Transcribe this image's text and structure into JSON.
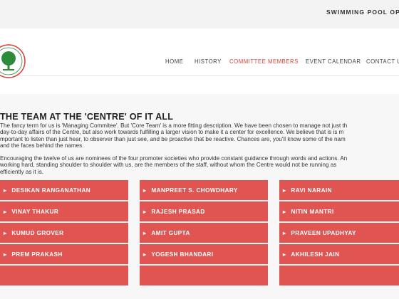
{
  "topbar": {
    "text": "SWIMMING POOL OPER"
  },
  "nav": {
    "items": [
      {
        "label": "HOME",
        "active": false
      },
      {
        "label": "HISTORY",
        "active": false
      },
      {
        "label": "COMMITTEE MEMBERS",
        "active": true
      },
      {
        "label": "EVENT CALENDAR",
        "active": false
      },
      {
        "label": "CONTACT U",
        "active": false
      }
    ]
  },
  "main": {
    "heading": "THE TEAM AT THE 'CENTRE' OF IT ALL",
    "paragraph1": [
      "The fancy term for us is 'Managing Commitee'. But 'Core Team' is a more fitting description. We have been chosen to manage not just th",
      "day-to-day affairs of the Centre, but also work towards fulfilling a larger vision to make it a center for excellence. We believe that is is m",
      "mportant to listen than just hear, to observer than just see, and be proactive that be reactive. Chances are, you'll know some of the nam",
      "and the faces behind the names."
    ],
    "paragraph2": [
      "Encouraging the twelve of us are nominees of the four promoter societies who provide constant guidance through words and actions. An",
      "working hard, standing shoulder to shoulder with us, are the members of the staff, without whom the Centre would not be running as",
      "efficiently as it is."
    ]
  },
  "members": [
    "DESIKAN RANGANATHAN",
    "MANPREET S. CHOWDHARY",
    "RAVI NARAIN",
    "VINAY THAKUR",
    "RAJESH PRASAD",
    "NITIN MANTRI",
    "KUMUD GROVER",
    "AMIT GUPTA",
    "PRAVEEN UPADHYAY",
    "PREM PRAKASH",
    "YOGESH BHANDARI",
    "AKHILESH JAIN"
  ],
  "colors": {
    "accent": "#e05551",
    "nav_active": "#d9413c",
    "logo_green": "#2e8b3a",
    "logo_red": "#d9413c"
  }
}
